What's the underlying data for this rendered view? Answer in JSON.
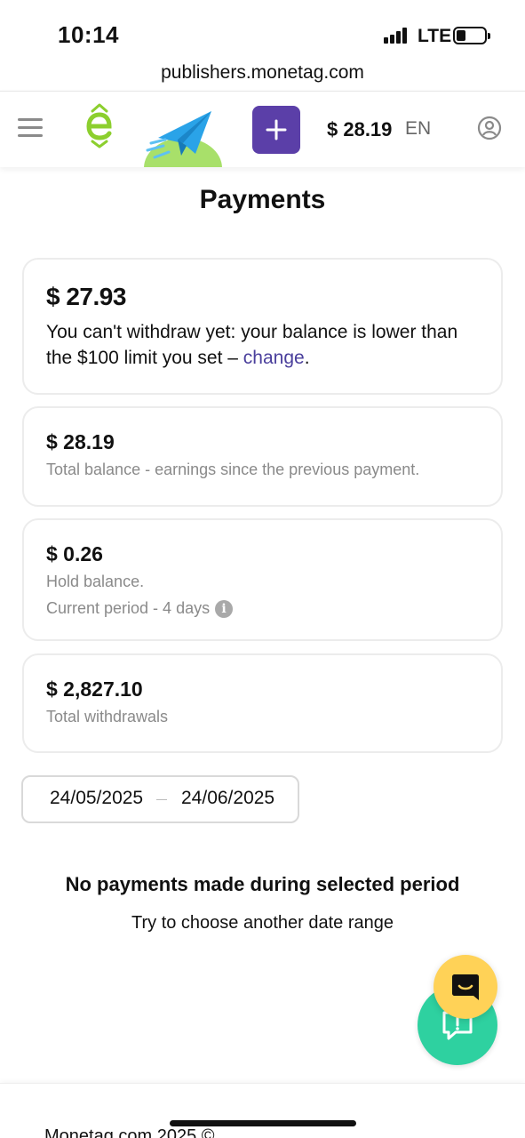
{
  "status_bar": {
    "time": "10:14",
    "network": "LTE"
  },
  "browser": {
    "url": "publishers.monetag.com"
  },
  "header": {
    "balance": "$ 28.19",
    "language": "EN",
    "add_label": "+",
    "icons": [
      "menu-icon",
      "logo-icon",
      "telegram-promo-icon",
      "plus-icon",
      "user-icon"
    ],
    "accent_color": "#5b3fa8"
  },
  "page": {
    "title": "Payments"
  },
  "cards": {
    "available": {
      "amount": "$ 27.93",
      "message_before": "You can't withdraw yet: your balance is lower than the $100 limit you set – ",
      "link": "change",
      "message_after": "."
    },
    "total": {
      "amount": "$ 28.19",
      "description": "Total balance - earnings since the previous payment."
    },
    "hold": {
      "amount": "$ 0.26",
      "description": "Hold balance.",
      "period": "Current period - 4 days",
      "info_glyph": "i"
    },
    "withdrawals": {
      "amount": "$ 2,827.10",
      "description": "Total withdrawals"
    }
  },
  "date_range": {
    "from": "24/05/2025",
    "to": "24/06/2025"
  },
  "empty_state": {
    "title": "No payments made during selected period",
    "subtitle": "Try to choose another date range"
  },
  "floating": {
    "chat_color": "#2ed1a0",
    "support_color": "#ffd257"
  },
  "footer": {
    "text": "Monetag.com 2025 ©"
  }
}
